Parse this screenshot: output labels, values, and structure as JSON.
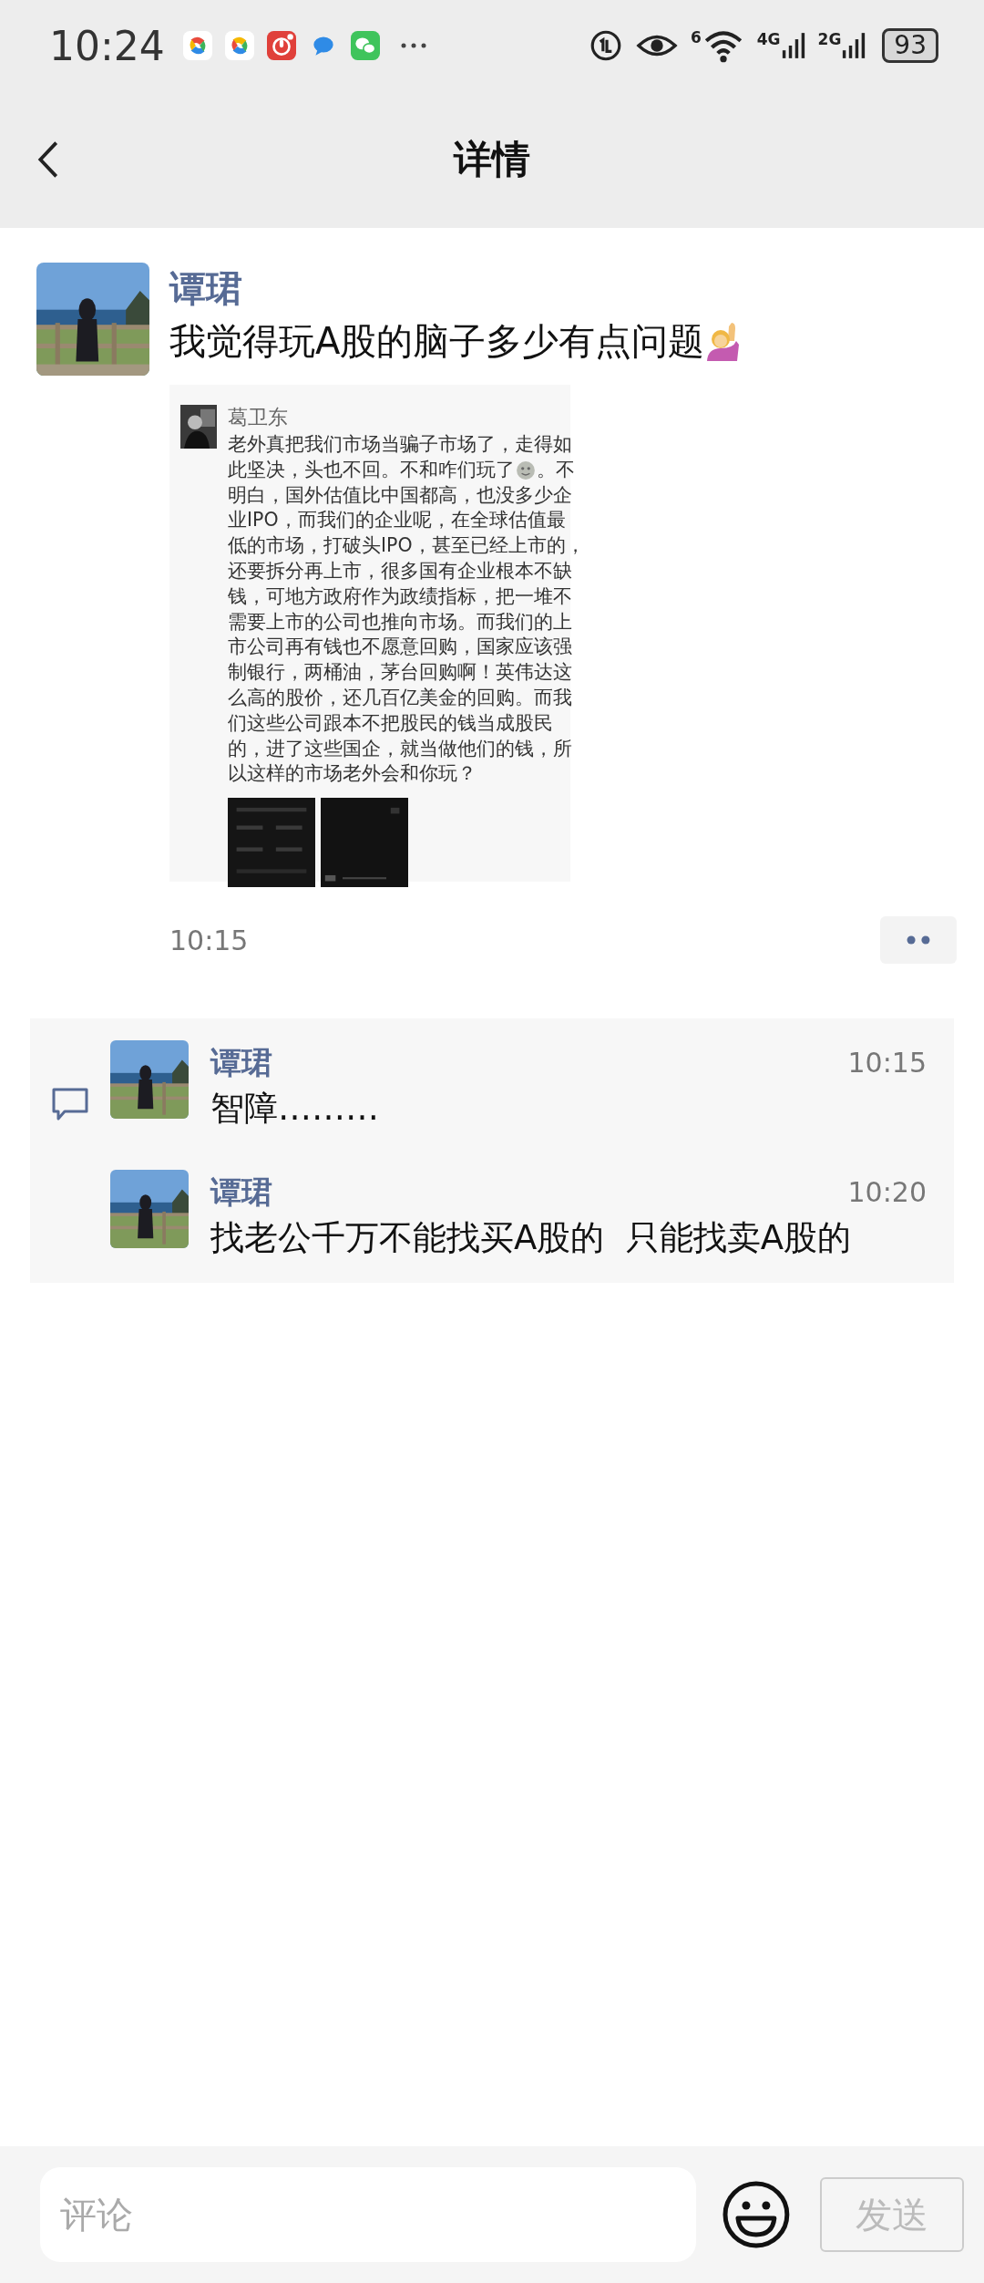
{
  "status_bar": {
    "time": "10:24",
    "wifi_label": "6",
    "cell_labels": [
      "4G",
      "2G"
    ],
    "battery": "93"
  },
  "header": {
    "title": "详情"
  },
  "post": {
    "author": "谭珺",
    "text": "我觉得玩A股的脑子多少有点问题",
    "time": "10:15",
    "embedded_screenshot": {
      "author": "葛卫东",
      "lines": [
        {
          "kind": "text",
          "text": "老外真把我们市场当骗子市场了，走得如"
        },
        {
          "kind": "emoji_split",
          "before": "此坚决，头也不回。不和咋们玩了",
          "after": "。不"
        },
        {
          "kind": "text",
          "text": "明白，国外估值比中国都高，也没多少企"
        },
        {
          "kind": "text",
          "text": "业IPO，而我们的企业呢，在全球估值最"
        },
        {
          "kind": "text",
          "text": "低的市场，打破头IPO，甚至已经上市的，"
        },
        {
          "kind": "text",
          "text": "还要拆分再上市，很多国有企业根本不缺"
        },
        {
          "kind": "text",
          "text": "钱，可地方政府作为政绩指标，把一堆不"
        },
        {
          "kind": "text",
          "text": "需要上市的公司也推向市场。而我们的上"
        },
        {
          "kind": "text",
          "text": "市公司再有钱也不愿意回购，国家应该强"
        },
        {
          "kind": "text",
          "text": "制银行，两桶油，茅台回购啊！英伟达这"
        },
        {
          "kind": "text",
          "text": "么高的股价，还几百亿美金的回购。而我"
        },
        {
          "kind": "text",
          "text": "们这些公司跟本不把股民的钱当成股民"
        },
        {
          "kind": "text",
          "text": "的，进了这些国企，就当做他们的钱，所"
        },
        {
          "kind": "text",
          "text": "以这样的市场老外会和你玩？"
        }
      ]
    }
  },
  "comments": [
    {
      "author": "谭珺",
      "time": "10:15",
      "text": "智障………"
    },
    {
      "author": "谭珺",
      "time": "10:20",
      "text": "找老公千万不能找买A股的  只能找卖A股的"
    }
  ],
  "comment_bar": {
    "placeholder": "评论",
    "send_label": "发送",
    "send_disabled": true
  }
}
